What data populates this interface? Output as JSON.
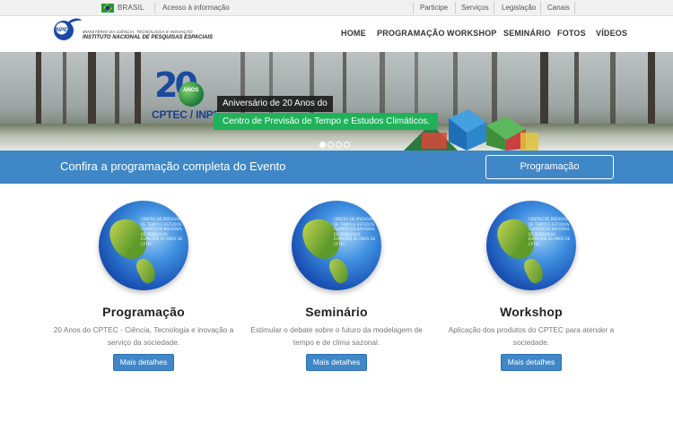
{
  "govbar": {
    "country": "BRASIL",
    "access": "Acesso à informação",
    "links": [
      "Participe",
      "Serviços",
      "Legislação",
      "Canais"
    ]
  },
  "header": {
    "logo_mark": "INPE",
    "logo_line1": "MINISTÉRIO DA CIÊNCIA, TECNOLOGIA E INOVAÇÃO",
    "logo_line2": "INSTITUTO NACIONAL DE PESQUISAS ESPACIAIS",
    "nav": [
      "HOME",
      "PROGRAMAÇÃO",
      "WORKSHOP",
      "SEMINÁRIO",
      "FOTOS",
      "VÍDEOS"
    ]
  },
  "hero": {
    "emblem_number": "20",
    "emblem_anos": "ANOS",
    "emblem_org": "CPTEC / INPE",
    "caption_line1": "Aniversário de 20 Anos do",
    "caption_line2": "Centro de Previsão de Tempo e Estudos Climáticos.",
    "slides": 4,
    "active_slide": 1
  },
  "cta": {
    "text": "Confira a programação completa do Evento",
    "button": "Programação"
  },
  "cards": [
    {
      "title": "Programação",
      "desc": "20 Anos do CPTEC - Ciência, Tecnologia e inovação a serviço da sociedade.",
      "button": "Mais detalhes"
    },
    {
      "title": "Seminário",
      "desc": "Estimular o debate sobre o futuro da modelagem de tempo e de clima sazonal.",
      "button": "Mais detalhes"
    },
    {
      "title": "Workshop",
      "desc": "Aplicação dos produtos do CPTEC para atender a sociedade.",
      "button": "Mais detalhes"
    }
  ],
  "globe_text": "CENTRO DE PREVISÃO DE TEMPO E ESTUDOS CLIMÁTICOS NACIONAL DE PESQUISAS ESPACIAIS 20 ANOS DE CPTEC"
}
